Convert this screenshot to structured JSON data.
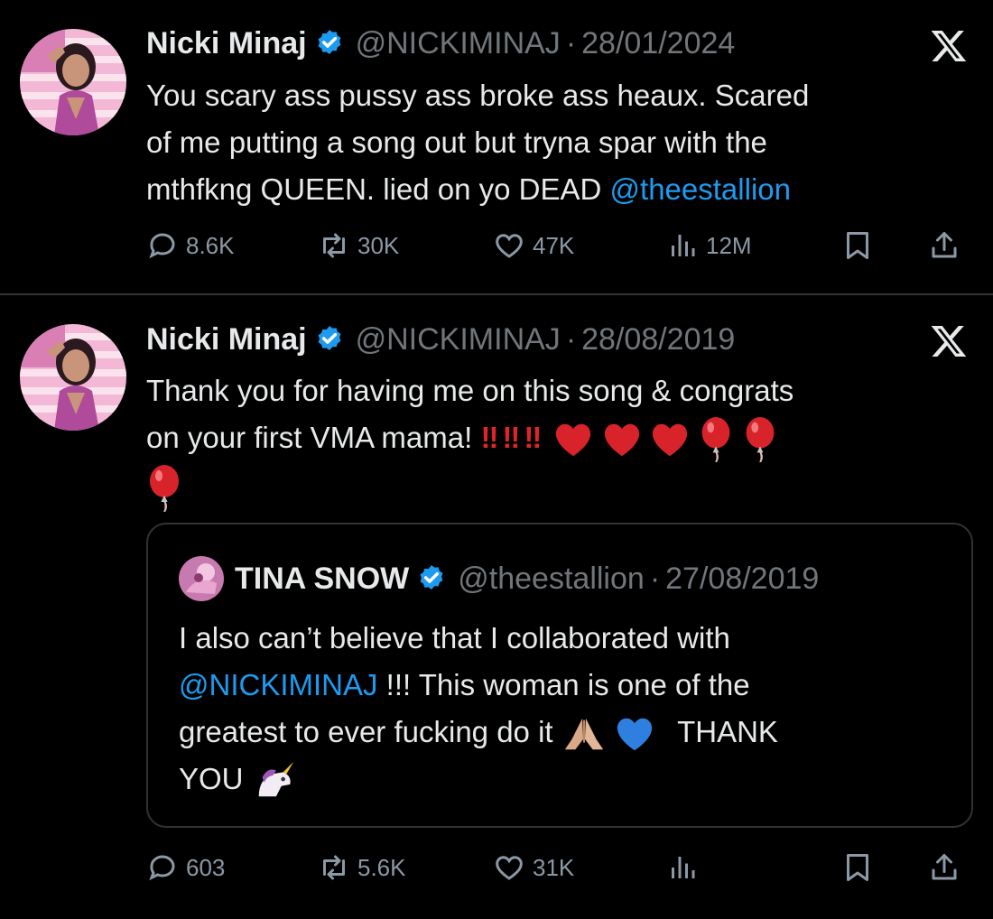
{
  "colors": {
    "background": "#000000",
    "text": "#e7e9ea",
    "muted": "#71767b",
    "accent": "#1d9bf0",
    "border": "#2f3336"
  },
  "tweets": [
    {
      "author_name": "Nicki Minaj",
      "handle": "@NICKIMINAJ",
      "separator": "·",
      "date": "28/01/2024",
      "text_line1": "You scary ass pussy ass broke ass heaux. Scared",
      "text_line2": "of me putting a song out but tryna spar with the",
      "text_line3_prefix": "mthfkng QUEEN. lied on yo DEAD ",
      "mention": "@theestallion",
      "stats": {
        "replies": "8.6K",
        "reposts": "30K",
        "likes": "47K",
        "views": "12M"
      }
    },
    {
      "author_name": "Nicki Minaj",
      "handle": "@NICKIMINAJ",
      "separator": "·",
      "date": "28/08/2019",
      "text_line1": "Thank you for having me on this song & congrats",
      "text_line2": "on your first VMA mama!",
      "bangs": [
        "‼",
        "‼",
        "‼"
      ],
      "stats": {
        "replies": "603",
        "reposts": "5.6K",
        "likes": "31K",
        "views": ""
      },
      "quote": {
        "author_name": "TINA SNOW",
        "handle": "@theestallion",
        "separator": "·",
        "date": "27/08/2019",
        "text_line1": "I also can’t believe that I collaborated with",
        "text_line2_mention": "@NICKIMINAJ",
        "text_line2_rest": " !!! This woman is one of the",
        "text_line3": "greatest to ever fucking do it",
        "text_line3_end": "THANK",
        "text_line4": "YOU"
      }
    }
  ],
  "icons": [
    "verified-badge-icon",
    "x-logo-icon",
    "reply-icon",
    "repost-icon",
    "like-icon",
    "views-icon",
    "bookmark-icon",
    "share-icon",
    "heart-emoji",
    "balloon-emoji",
    "pray-emoji",
    "blue-heart-emoji",
    "unicorn-emoji"
  ]
}
